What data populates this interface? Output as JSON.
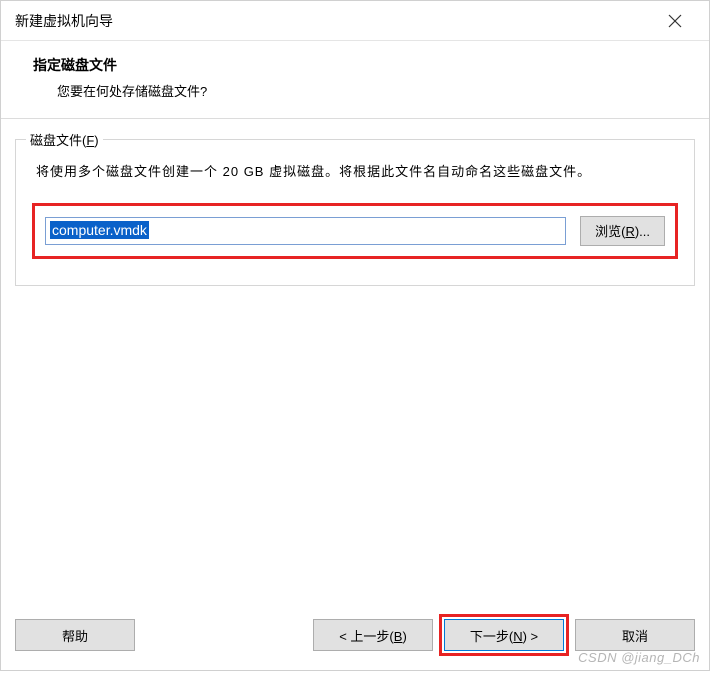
{
  "window": {
    "title": "新建虚拟机向导"
  },
  "header": {
    "title": "指定磁盘文件",
    "subtitle": "您要在何处存储磁盘文件?"
  },
  "group": {
    "label_pre": "磁盘文件(",
    "label_key": "F",
    "label_post": ")",
    "desc_pre": "将使用多个磁盘文件创建一个 ",
    "desc_size": "20 GB",
    "desc_post": " 虚拟磁盘。将根据此文件名自动命名这些磁盘文件。"
  },
  "file": {
    "value": "computer.vmdk",
    "browse_pre": "浏览(",
    "browse_key": "R",
    "browse_post": ")..."
  },
  "buttons": {
    "help": "帮助",
    "back_pre": "< 上一步(",
    "back_key": "B",
    "back_post": ")",
    "next_pre": "下一步(",
    "next_key": "N",
    "next_post": ") >",
    "cancel": "取消"
  },
  "watermark": "CSDN @jiang_DCh"
}
